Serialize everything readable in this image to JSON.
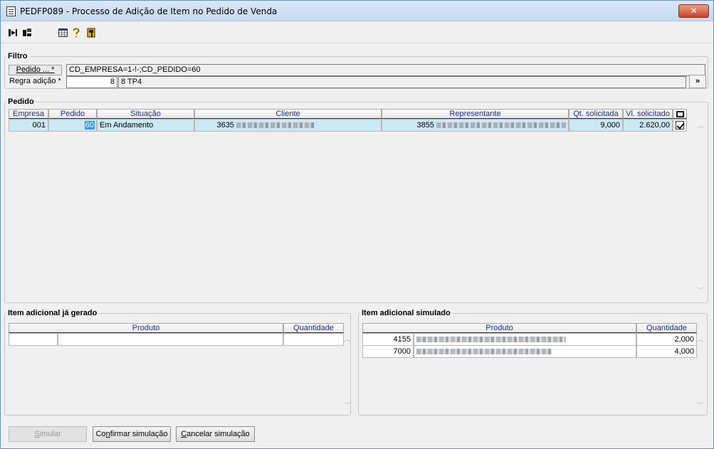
{
  "window": {
    "title": "PEDFP089 - Processo de Adição de Item no Pedido de Venda",
    "close_label": "✕"
  },
  "toolbar": {
    "icons": [
      "arrow-in-icon",
      "arrow-out-icon",
      "calendar-grid-icon",
      "help-icon",
      "exit-door-icon"
    ]
  },
  "filtro": {
    "legend": "Filtro",
    "pedido_label": "Pedido ... *",
    "pedido_value": "CD_EMPRESA=1-!-;CD_PEDIDO=60",
    "regra_label": "Regra adição *",
    "regra_code": "8",
    "regra_desc": "8 TP4",
    "more_button": "»"
  },
  "pedido": {
    "legend": "Pedido",
    "columns": [
      "Empresa",
      "Pedido",
      "Situação",
      "Cliente",
      "Representante",
      "Qt. solicitada",
      "Vl. solicitado"
    ],
    "rows": [
      {
        "empresa": "001",
        "pedido": "60",
        "situacao": "Em Andamento",
        "cliente": "3635",
        "representante": "3855",
        "qt_solicitada": "9,000",
        "vl_solicitado": "2.620,00",
        "checked": true
      }
    ]
  },
  "item_gerado": {
    "legend": "Item adicional já gerado",
    "columns": [
      "Produto",
      "Quantidade"
    ]
  },
  "item_simulado": {
    "legend": "Item adicional simulado",
    "columns": [
      "Produto",
      "Quantidade"
    ],
    "rows": [
      {
        "codigo": "4155",
        "quantidade": "2,000"
      },
      {
        "codigo": "7000",
        "quantidade": "4,000"
      }
    ]
  },
  "buttons": {
    "simular_pre": "S",
    "simular_rest": "imular",
    "confirmar_pre": "Co",
    "confirmar_u": "n",
    "confirmar_rest": "firmar simulação",
    "cancelar_u": "C",
    "cancelar_rest": "ancelar simulação"
  }
}
